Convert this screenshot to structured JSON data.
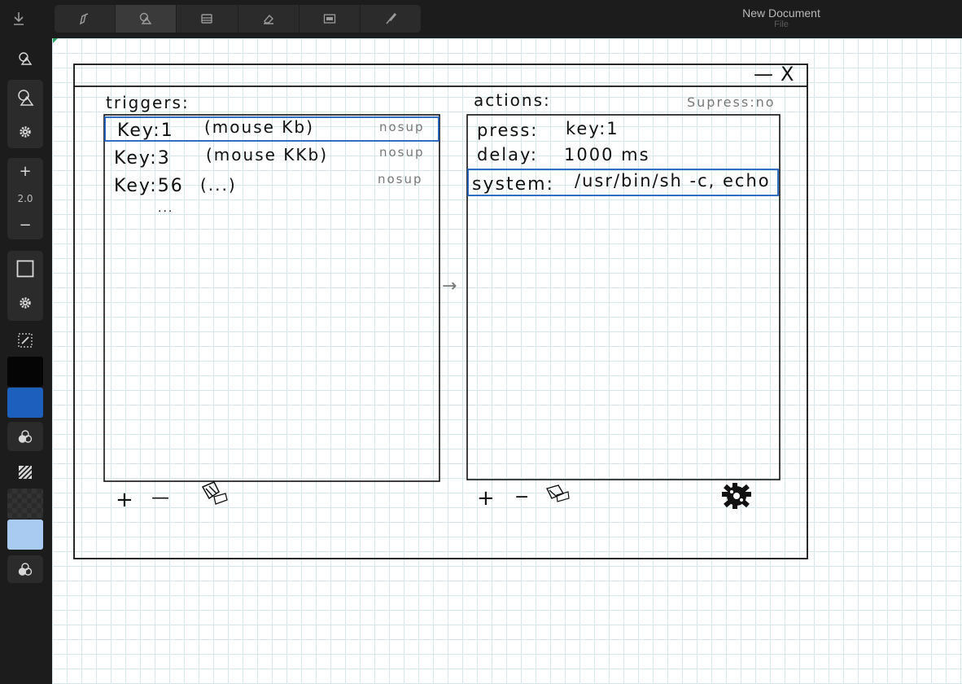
{
  "document": {
    "title": "New Document",
    "subtitle": "File"
  },
  "toolbar": {
    "tools": [
      {
        "icon": "pen-icon"
      },
      {
        "icon": "shape-select-icon",
        "active": true
      },
      {
        "icon": "stamp-icon"
      },
      {
        "icon": "eraser-icon"
      },
      {
        "icon": "selection-rect-icon"
      },
      {
        "icon": "brush-icon"
      }
    ]
  },
  "sidebar": {
    "stroke_size": "2.0",
    "colors": {
      "primary": "#050505",
      "secondary": "#1c5fbd",
      "fill_primary": "#2a2a2a",
      "fill_secondary": "#a9cbf2"
    }
  },
  "sketch": {
    "triggers_label": "triggers:",
    "actions_label": "actions:",
    "suppress_label": "Supress:no",
    "triggers": [
      {
        "key": "Key:1",
        "source": "(mouse Kb)",
        "suppress": "nosup"
      },
      {
        "key": "Key:3",
        "source": "(mouse KKb)",
        "suppress": "nosup"
      },
      {
        "key": "Key:56",
        "source": "(...)",
        "suppress": "nosup"
      }
    ],
    "more": "...",
    "actions": [
      {
        "type": "press:",
        "value": "key:1"
      },
      {
        "type": "delay:",
        "value": "1000 ms"
      },
      {
        "type": "system:",
        "value": "/usr/bin/sh -c, echo"
      }
    ],
    "window_minimize": "—",
    "window_close": "X",
    "arrow": "→",
    "add_sign": "+",
    "remove_sign": "—",
    "remove_sign_right": "−"
  }
}
